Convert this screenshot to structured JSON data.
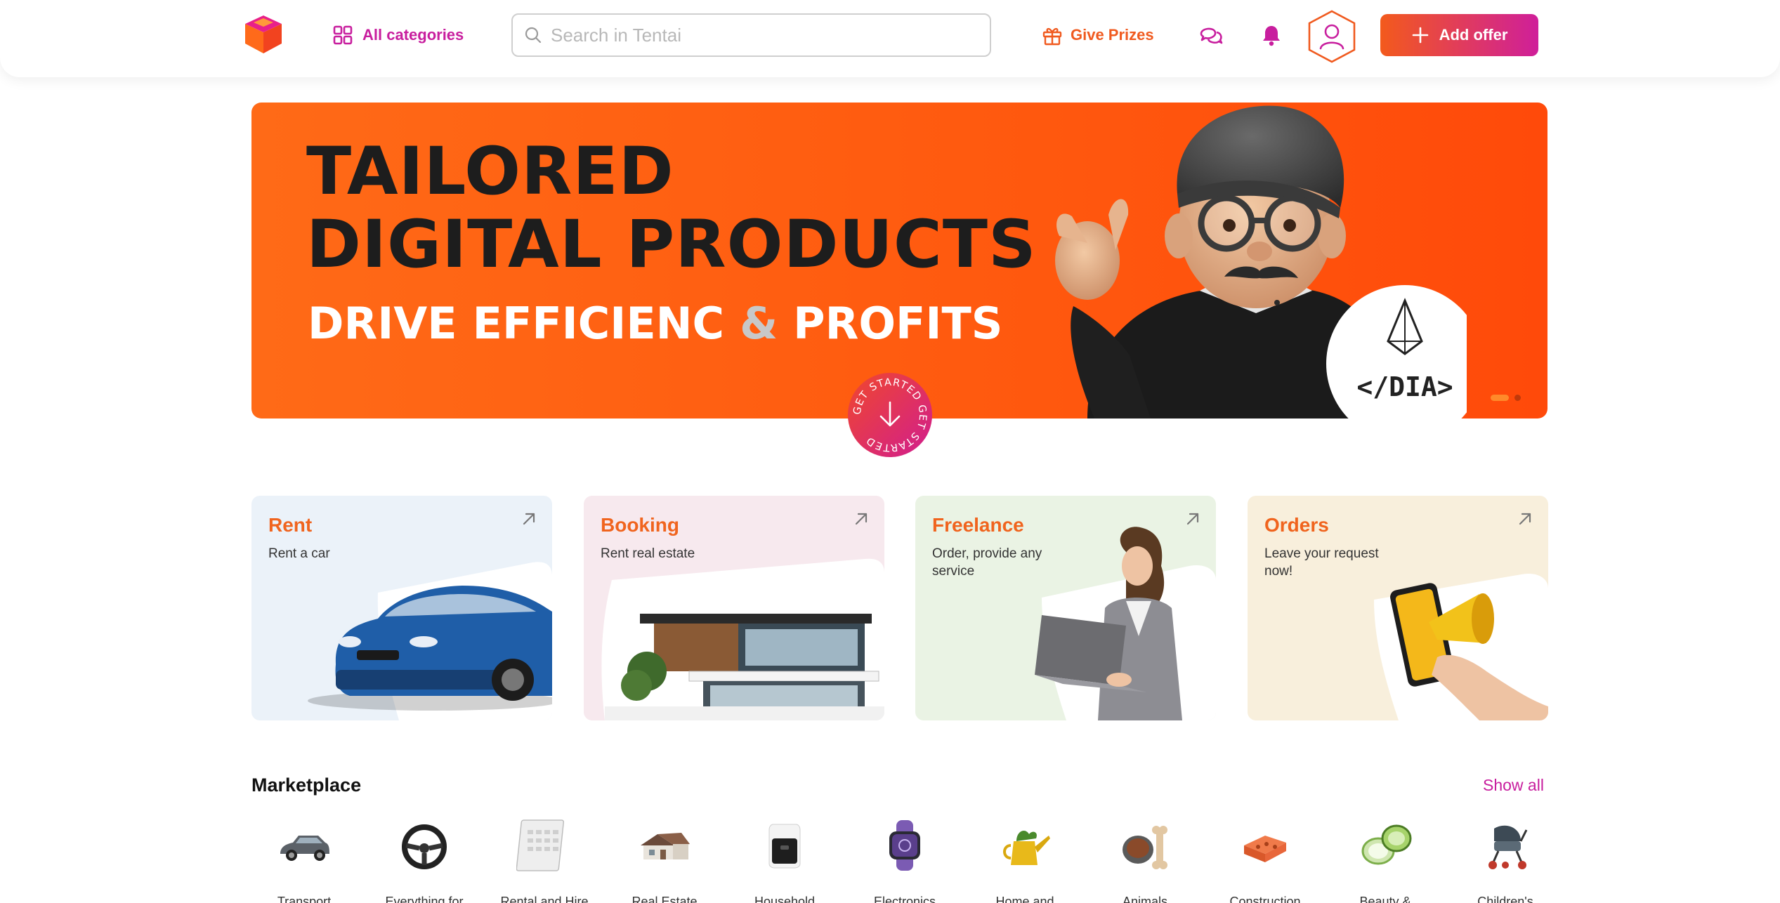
{
  "header": {
    "all_categories": "All categories",
    "search_placeholder": "Search in Tentai",
    "give_prizes": "Give Prizes",
    "add_offer": "Add offer"
  },
  "banner": {
    "line1": "TAILORED",
    "line2": "DIGITAL PRODUCTS",
    "line3_a": "DRIVE",
    "line3_b": "EFFICIENC",
    "line3_amp": "&",
    "line3_c": "PROFITS",
    "badge_text": "</DIA>",
    "get_started": "GET STARTED GET STARTED"
  },
  "cards": [
    {
      "title": "Rent",
      "subtitle": "Rent a car",
      "bg": "#ebf2f9"
    },
    {
      "title": "Booking",
      "subtitle": "Rent real estate",
      "bg": "#f7e9ee"
    },
    {
      "title": "Freelance",
      "subtitle": "Order, provide any service",
      "bg": "#eaf3e4"
    },
    {
      "title": "Orders",
      "subtitle": "Leave your request now!",
      "bg": "#f8efdc"
    }
  ],
  "marketplace": {
    "title": "Marketplace",
    "show_all": "Show all",
    "items": [
      {
        "label": "Transport",
        "icon": "suv-car-icon"
      },
      {
        "label": "Everything for",
        "icon": "steering-wheel-icon"
      },
      {
        "label": "Rental and Hire",
        "icon": "calendar-icon"
      },
      {
        "label": "Real Estate",
        "icon": "house-icon"
      },
      {
        "label": "Household",
        "icon": "air-fryer-icon"
      },
      {
        "label": "Electronics",
        "icon": "smartwatch-icon"
      },
      {
        "label": "Home and",
        "icon": "watering-can-icon"
      },
      {
        "label": "Animals",
        "icon": "pet-bowl-bone-icon"
      },
      {
        "label": "Construction",
        "icon": "bricks-icon"
      },
      {
        "label": "Beauty &",
        "icon": "cosmetic-jar-icon"
      },
      {
        "label": "Children's",
        "icon": "stroller-icon"
      }
    ]
  },
  "colors": {
    "accent_magenta": "#c81e9e",
    "accent_orange": "#f05a1f",
    "banner_orange": "#ff5a0f"
  }
}
